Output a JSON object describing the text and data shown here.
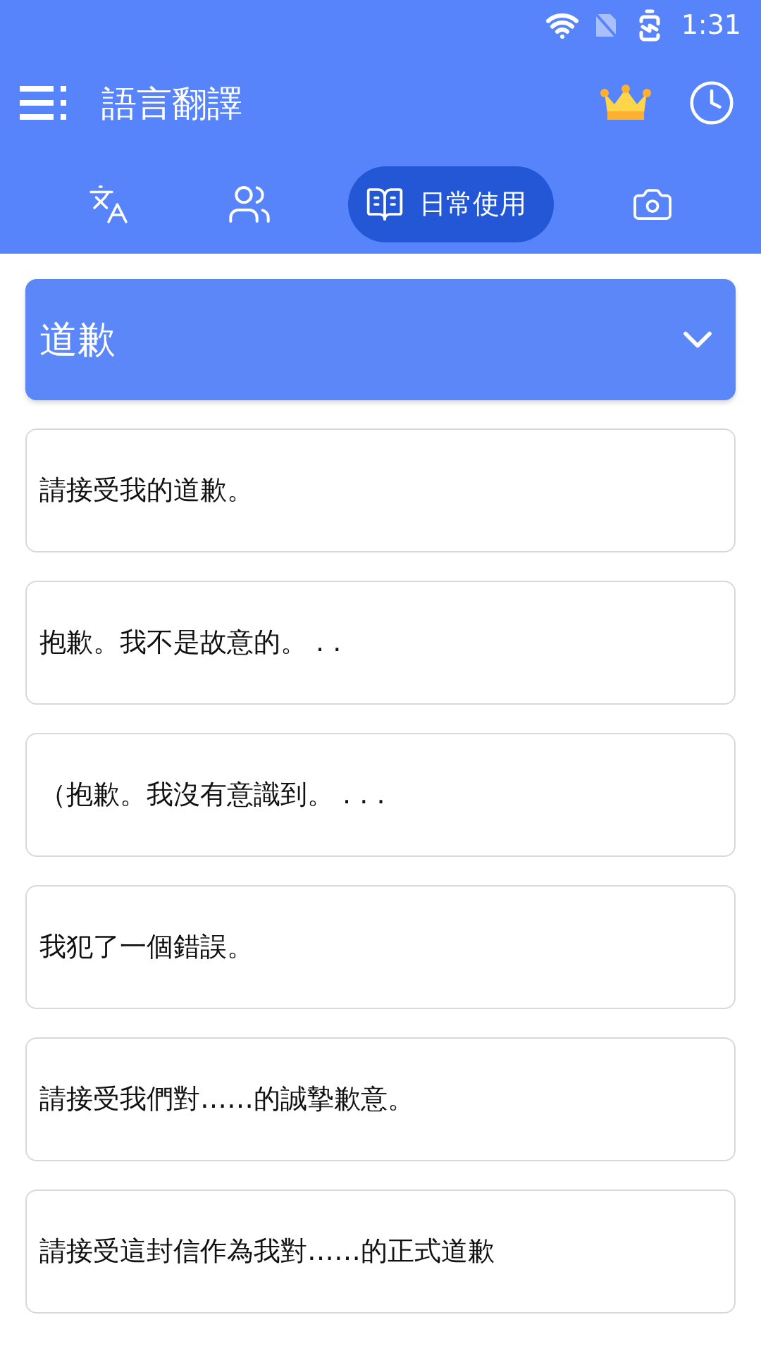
{
  "status_bar": {
    "time": "1:31"
  },
  "app_bar": {
    "title": "語言翻譯"
  },
  "tabs": [
    {
      "kind": "translate",
      "selected": false
    },
    {
      "kind": "people",
      "selected": false
    },
    {
      "kind": "phrasebook",
      "label": "日常使用",
      "selected": true
    },
    {
      "kind": "camera",
      "selected": false
    }
  ],
  "category": {
    "label": "道歉",
    "expanded": false
  },
  "phrases": [
    "請接受我的道歉。",
    "抱歉。我不是故意的。 . .",
    "（抱歉。我沒有意識到。 . . .",
    "我犯了一個錯誤。",
    "請接受我們對……的誠摯歉意。",
    "請接受這封信作為我對……的正式道歉"
  ]
}
